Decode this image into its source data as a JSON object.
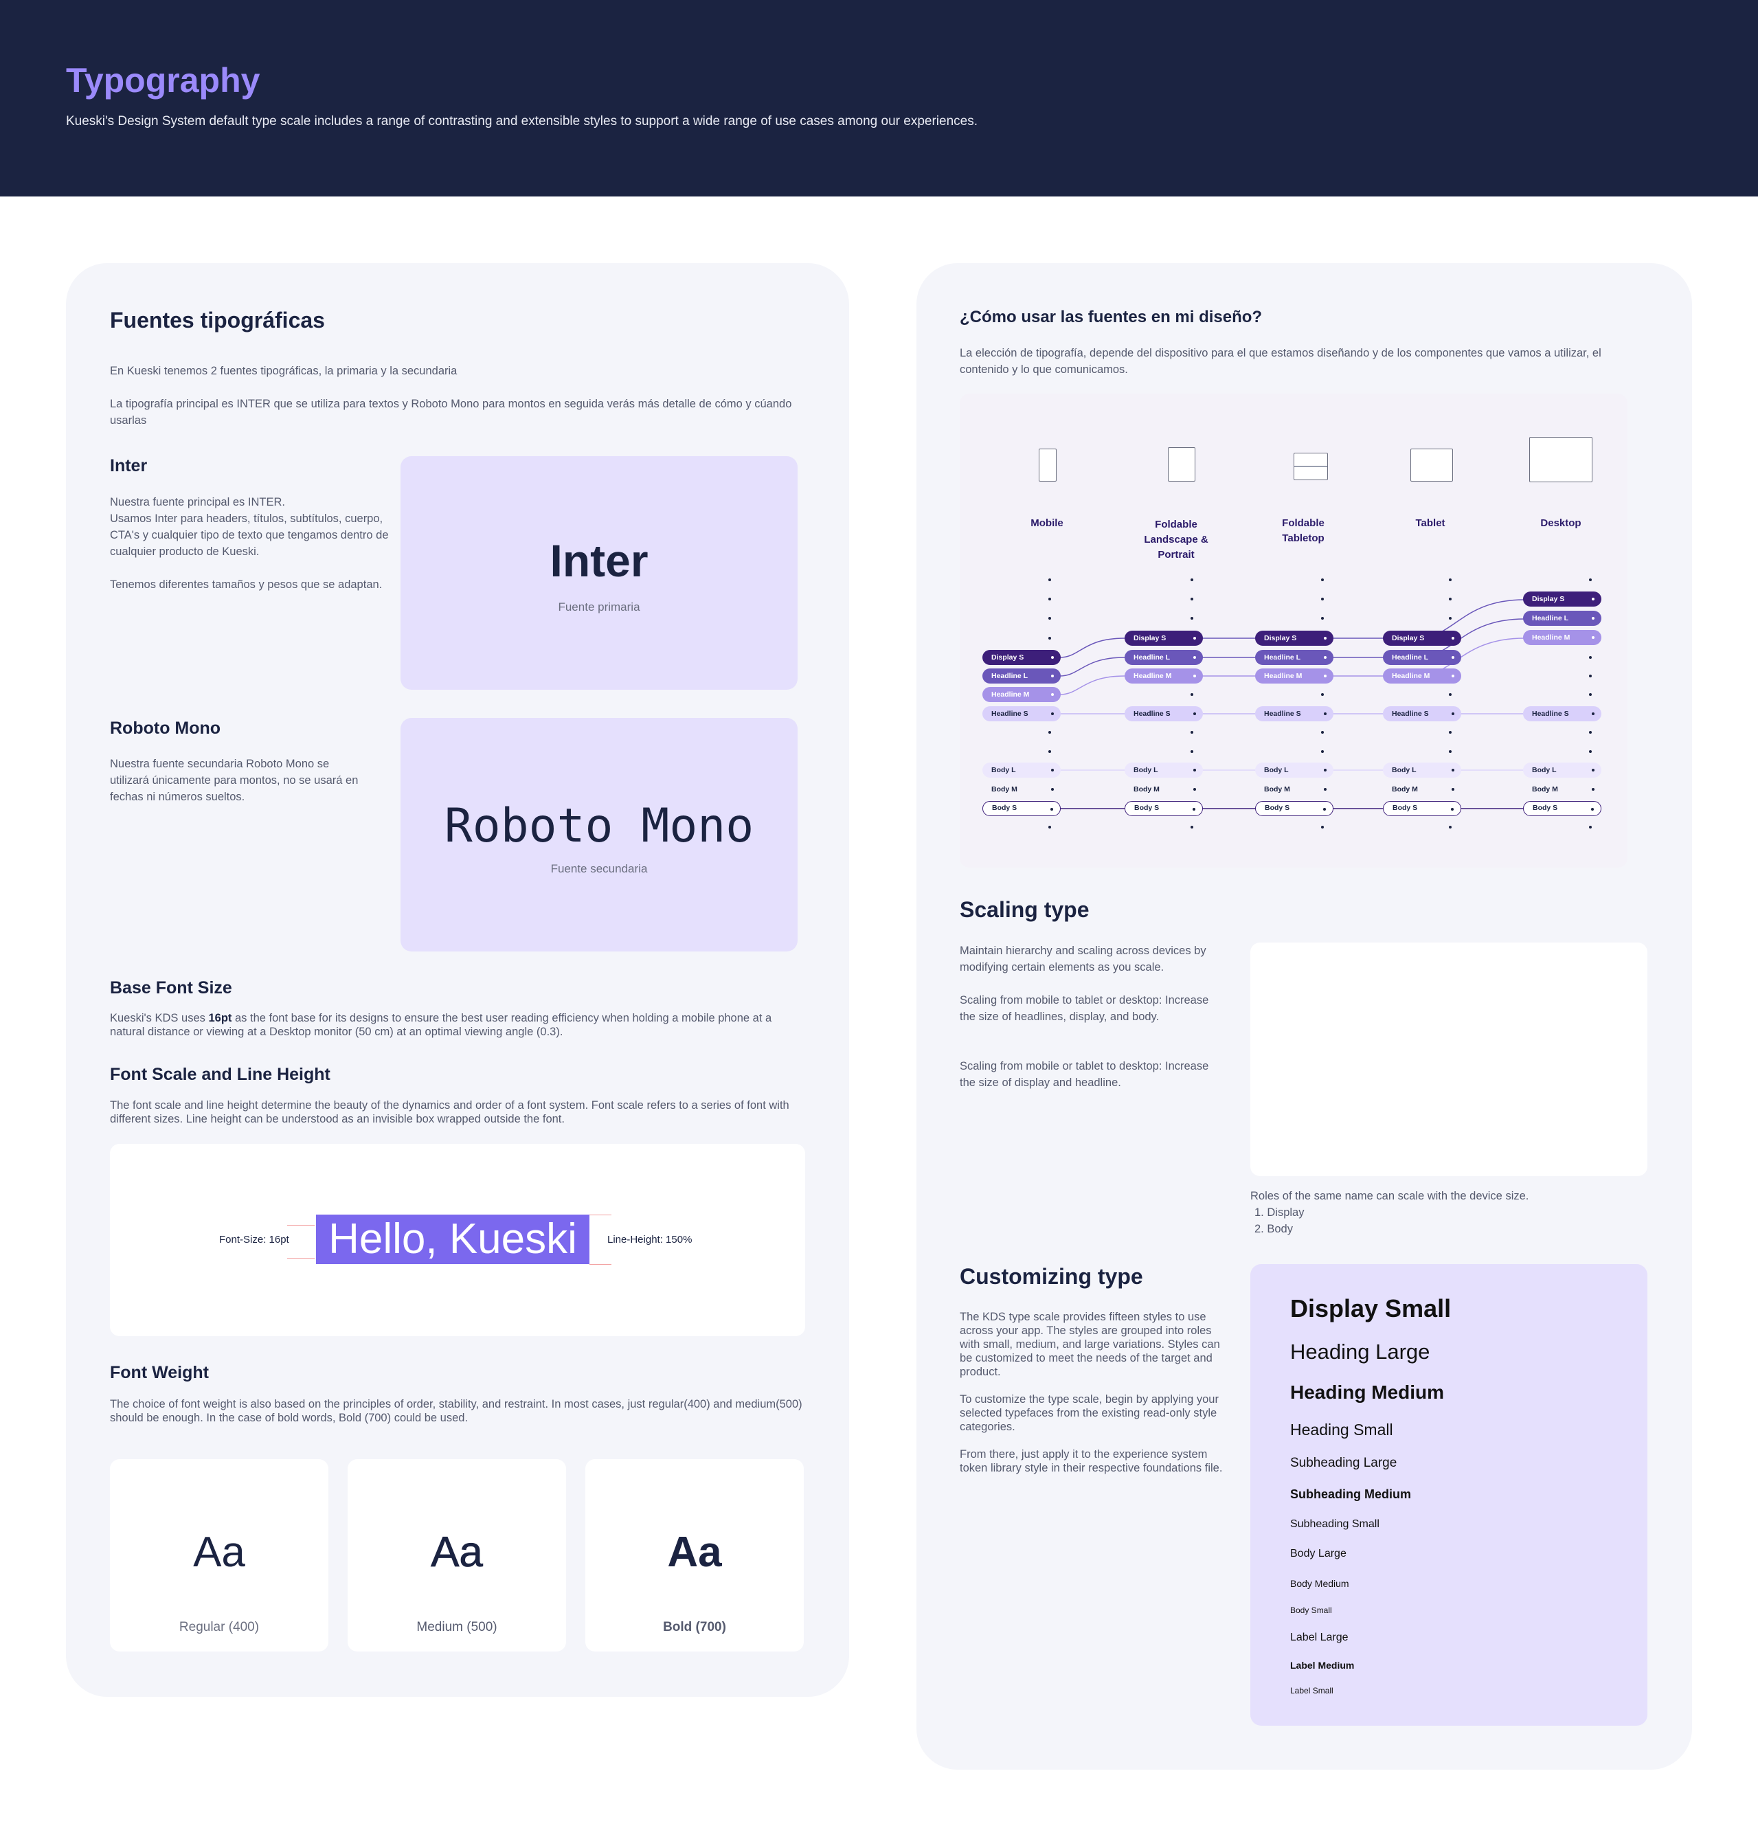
{
  "header": {
    "title": "Typography",
    "subtitle": "Kueski's Design System default type scale includes a range of contrasting and extensible styles to support a wide range of use cases among our experiences."
  },
  "fonts": {
    "title": "Fuentes tipográficas",
    "intro1": "En Kueski tenemos 2 fuentes tipográficas, la primaria y la secundaria",
    "intro2": "La tipografía principal es INTER que se utiliza para textos y  Roboto Mono para montos en seguida verás más detalle de cómo y cúando usarlas",
    "inter": {
      "title": "Inter",
      "desc": "Nuestra fuente principal es INTER.\nUsamos Inter para headers, títulos, subtítulos, cuerpo, CTA's y cualquier tipo de texto que tengamos dentro de cualquier producto de Kueski.\n\nTenemos diferentes tamaños y pesos que se adaptan.",
      "specimen": "Inter",
      "caption": "Fuente primaria"
    },
    "roboto": {
      "title": "Roboto Mono",
      "desc": "Nuestra fuente secundaria Roboto Mono se utilizará únicamente para montos, no se usará en fechas ni números sueltos.",
      "specimen": "Roboto Mono",
      "caption": "Fuente secundaria"
    }
  },
  "base_font": {
    "title": "Base Font Size",
    "text_before": "Kueski's KDS uses ",
    "text_bold": "16pt",
    "text_after": " as the font base for its designs to ensure the best user reading efficiency when holding a mobile phone at a natural distance or viewing at a Desktop monitor (50 cm) at an optimal viewing angle (0.3)."
  },
  "font_scale": {
    "title": "Font Scale and Line Height",
    "desc": "The font scale and line height determine the beauty of the dynamics and order of a font system. Font scale refers to a series of font with different sizes. Line height can be understood as an invisible box wrapped outside the font.",
    "font_size_label": "Font-Size: 16pt",
    "sample": "Hello, Kueski",
    "line_height_label": "Line-Height: 150%",
    "highlight_color": "#7b68ee"
  },
  "font_weight": {
    "title": "Font Weight",
    "desc": "The choice of font weight is also based on the principles of order, stability, and restraint. In most cases, just regular(400) and medium(500) should be enough. In the case of bold words, Bold (700) could be used.",
    "samples": [
      {
        "glyph": "Aa",
        "label": "Regular (400)"
      },
      {
        "glyph": "Aa",
        "label": "Medium (500)"
      },
      {
        "glyph": "Aa",
        "label": "Bold (700)"
      }
    ]
  },
  "usage": {
    "title": "¿Cómo usar las fuentes en mi diseño?",
    "desc": "La elección de tipografía, depende del dispositivo para el que estamos diseñando y de los componentes que vamos a utilizar, el contenido y lo que comunicamos.",
    "devices": [
      "Mobile",
      "Foldable\nLandscape &\nPortrait",
      "Foldable\nTabletop",
      "Tablet",
      "Desktop"
    ],
    "styles": {
      "display_s": "Display S",
      "headline_l": "Headline L",
      "headline_m": "Headline M",
      "headline_s": "Headline S",
      "body_l": "Body L",
      "body_m": "Body M",
      "body_s": "Body S"
    }
  },
  "scaling": {
    "title": "Scaling type",
    "p1": "Maintain hierarchy and scaling across devices by modifying certain elements as you scale.",
    "p2": "Scaling from mobile to tablet or desktop: Increase the size of headlines, display, and body.",
    "p3": "Scaling from mobile or tablet to desktop: Increase the size of display and headline.",
    "roles_note": "Roles of the same name can scale with the device size.",
    "roles": [
      "Display",
      "Body"
    ]
  },
  "customizing": {
    "title": "Customizing type",
    "p1": "The KDS type scale provides fifteen styles to use across your app. The styles are grouped into roles with small, medium, and large variations. Styles can be customized to meet the needs of the target and product.",
    "p2": "To customize the type scale, begin by applying your selected typefaces from the existing read-only style categories.",
    "p3": "From there, just apply it to the experience system token library style in their respective foundations file.",
    "scale": [
      "Display Small",
      "Heading Large",
      "Heading Medium",
      "Heading Small",
      "Subheading Large",
      "Subheading Medium",
      "Subheading Small",
      "Body Large",
      "Body Medium",
      "Body Small",
      "Label Large",
      "Label Medium",
      "Label Small"
    ]
  },
  "colors": {
    "navy": "#1b2341",
    "purple_accent": "#9b8afb",
    "lavender": "#e5e0fd",
    "card_bg": "#f4f5fa"
  }
}
